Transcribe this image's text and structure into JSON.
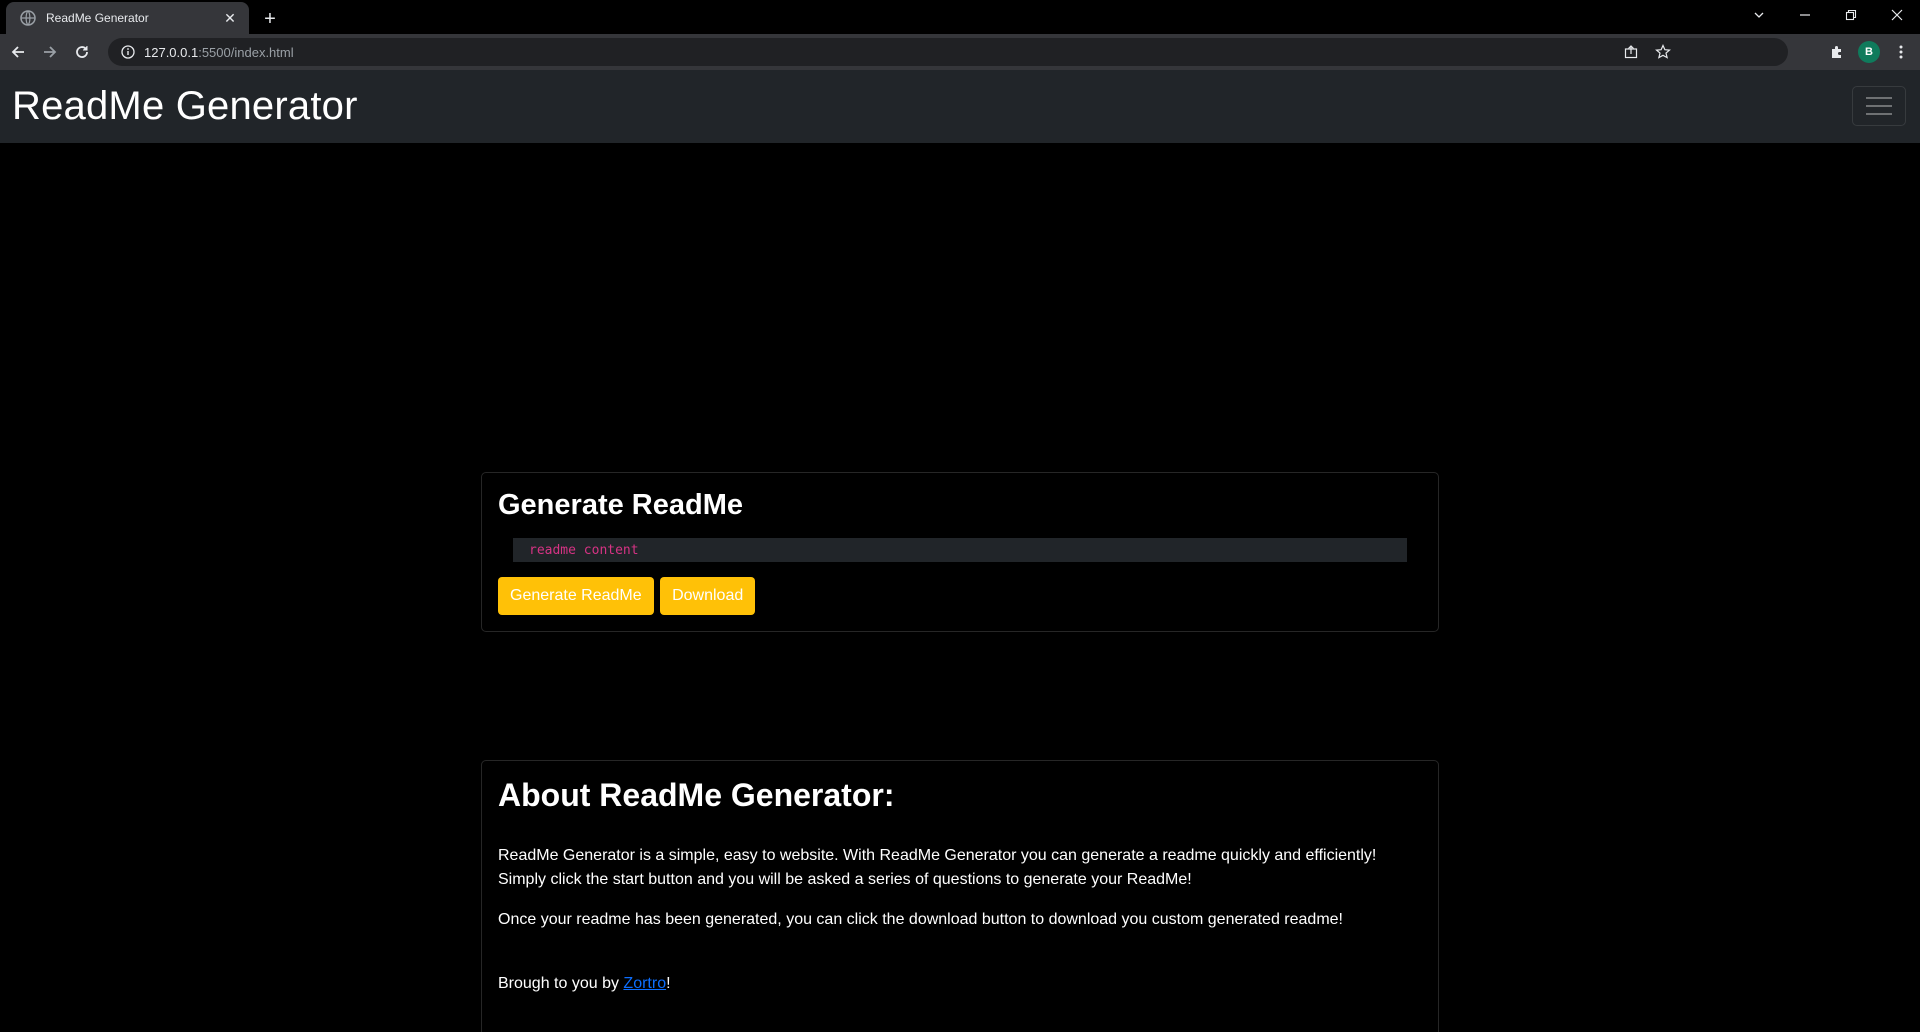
{
  "browser": {
    "tab_title": "ReadMe Generator",
    "tab_close": "✕",
    "new_tab": "+",
    "url_host": "127.0.0.1",
    "url_rest": ":5500/index.html",
    "profile_initial": "B"
  },
  "navbar": {
    "brand": "ReadMe Generator"
  },
  "generate": {
    "title": "Generate ReadMe",
    "code_content": "readme content",
    "generate_button": "Generate ReadMe",
    "download_button": "Download"
  },
  "about": {
    "title": "About ReadMe Generator:",
    "paragraph1": "ReadMe Generator is a simple, easy to website. With ReadMe Generator you can generate a readme quickly and efficiently! Simply click the start button and you will be asked a series of questions to generate your ReadMe!",
    "paragraph2": "Once your readme has been generated, you can click the download button to download you custom generated readme!",
    "credit_prefix": "Brough to you by ",
    "credit_link": "Zortro",
    "credit_suffix": "!"
  },
  "colors": {
    "accent": "#ffc107",
    "navbar_bg": "#212529",
    "link": "#0d6efd",
    "code": "#d63384"
  }
}
